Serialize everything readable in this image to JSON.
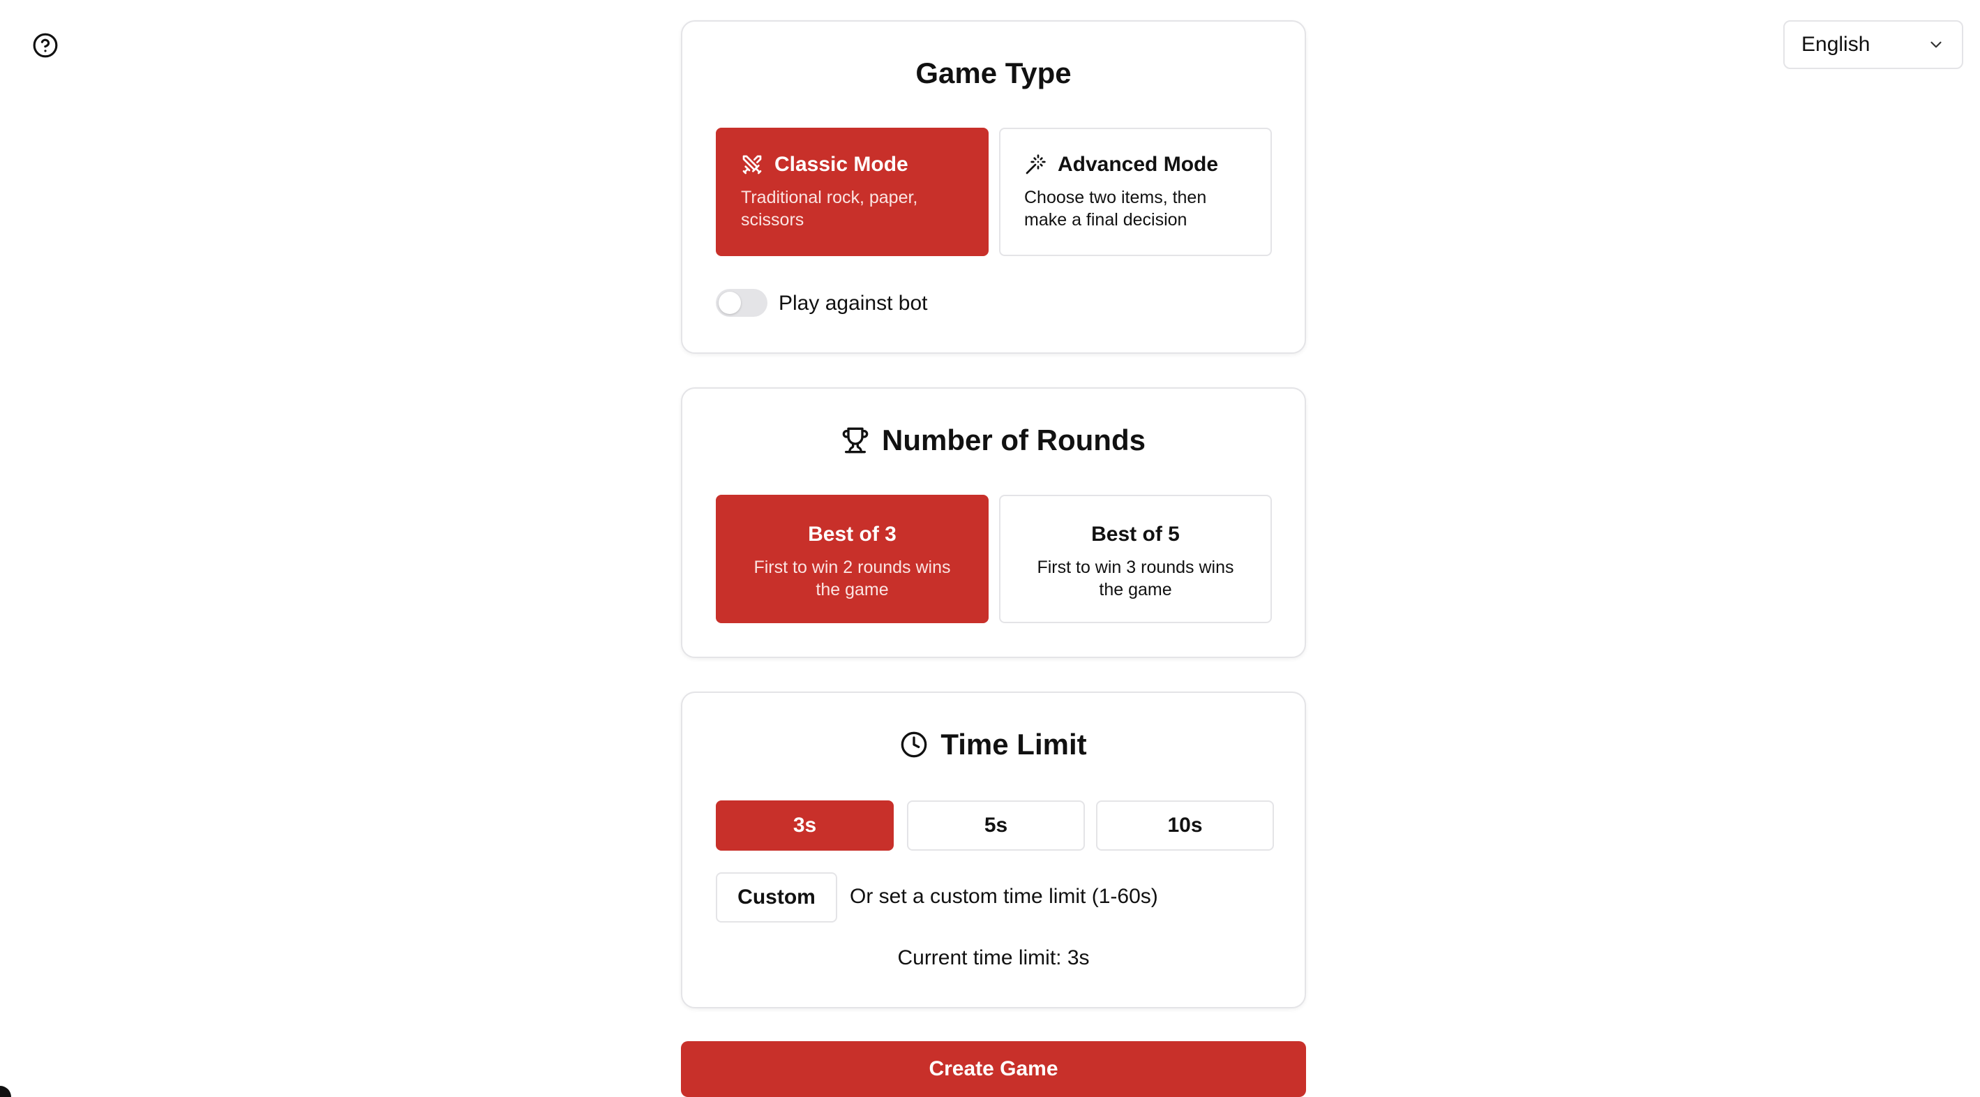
{
  "help": {
    "icon": "help-circle-icon"
  },
  "language": {
    "selected": "English",
    "icon": "chevron-down-icon"
  },
  "game_type": {
    "title": "Game Type",
    "modes": [
      {
        "label": "Classic Mode",
        "description": "Traditional rock, paper, scissors",
        "icon": "swords-icon",
        "selected": true
      },
      {
        "label": "Advanced Mode",
        "description": "Choose two items, then make a final decision",
        "icon": "magic-wand-icon",
        "selected": false
      }
    ],
    "bot_toggle": {
      "label": "Play against bot",
      "on": false
    }
  },
  "rounds": {
    "title": "Number of Rounds",
    "icon": "trophy-icon",
    "options": [
      {
        "label": "Best of 3",
        "description": "First to win 2 rounds wins the game",
        "selected": true
      },
      {
        "label": "Best of 5",
        "description": "First to win 3 rounds wins the game",
        "selected": false
      }
    ]
  },
  "time_limit": {
    "title": "Time Limit",
    "icon": "clock-icon",
    "options": [
      {
        "label": "3s",
        "selected": true
      },
      {
        "label": "5s",
        "selected": false
      },
      {
        "label": "10s",
        "selected": false
      }
    ],
    "custom_label": "Custom",
    "custom_hint": "Or set a custom time limit (1-60s)",
    "current": "Current time limit: 3s"
  },
  "create_button": "Create Game",
  "colors": {
    "accent": "#c8302a",
    "border": "#e4e4e7"
  }
}
